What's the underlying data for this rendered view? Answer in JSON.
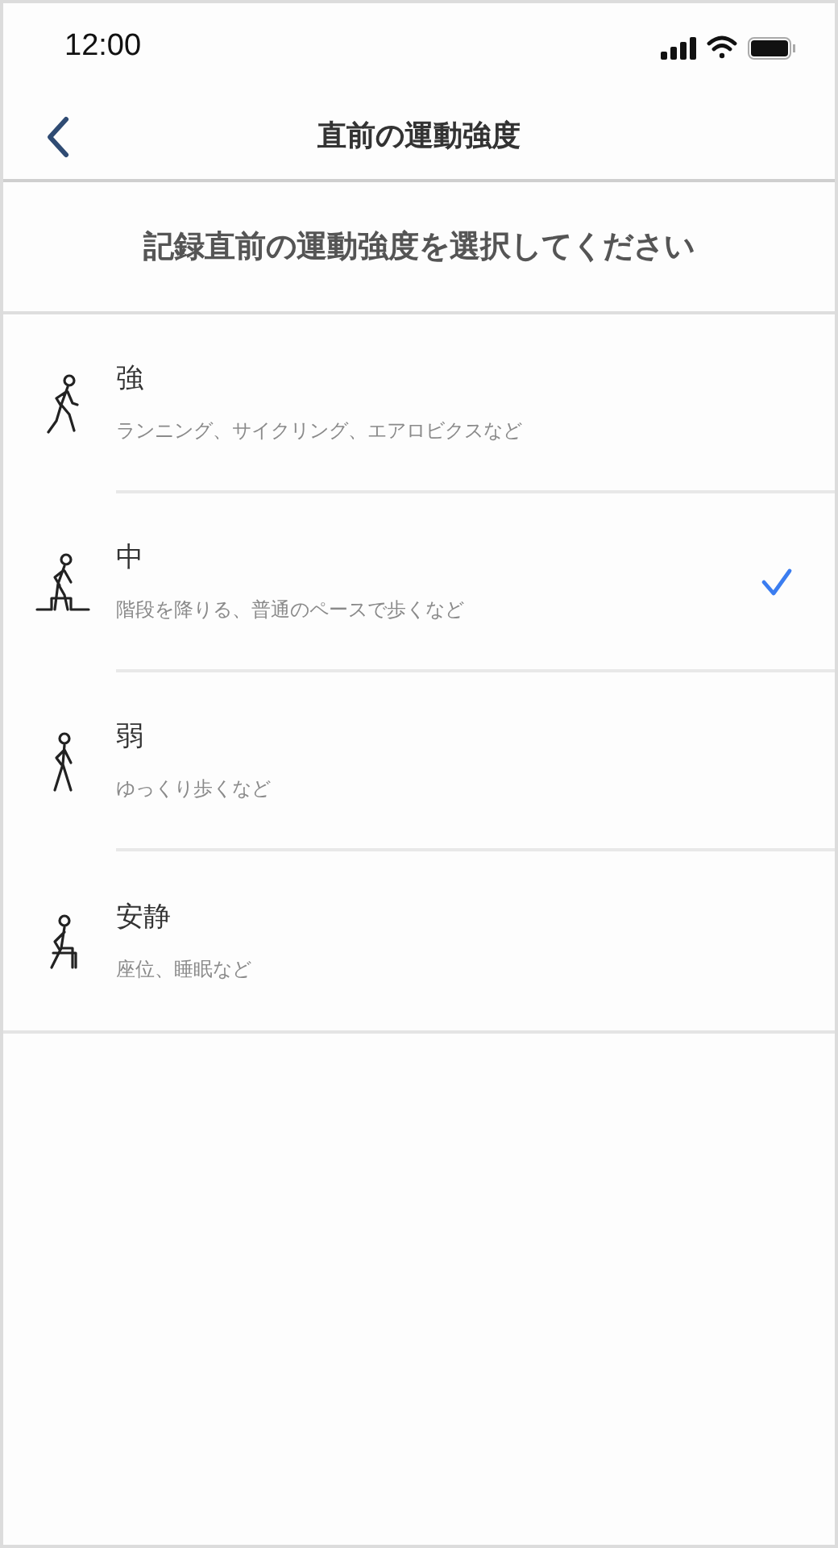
{
  "status_bar": {
    "time": "12:00"
  },
  "nav": {
    "title": "直前の運動強度"
  },
  "prompt": "記録直前の運動強度を選択してください",
  "options": [
    {
      "kind": "running",
      "label": "強",
      "description": "ランニング、サイクリング、エアロビクスなど",
      "selected": false
    },
    {
      "kind": "stairs",
      "label": "中",
      "description": "階段を降りる、普通のペースで歩くなど",
      "selected": true
    },
    {
      "kind": "walking",
      "label": "弱",
      "description": "ゆっくり歩くなど",
      "selected": false
    },
    {
      "kind": "sitting",
      "label": "安静",
      "description": "座位、睡眠など",
      "selected": false
    }
  ]
}
